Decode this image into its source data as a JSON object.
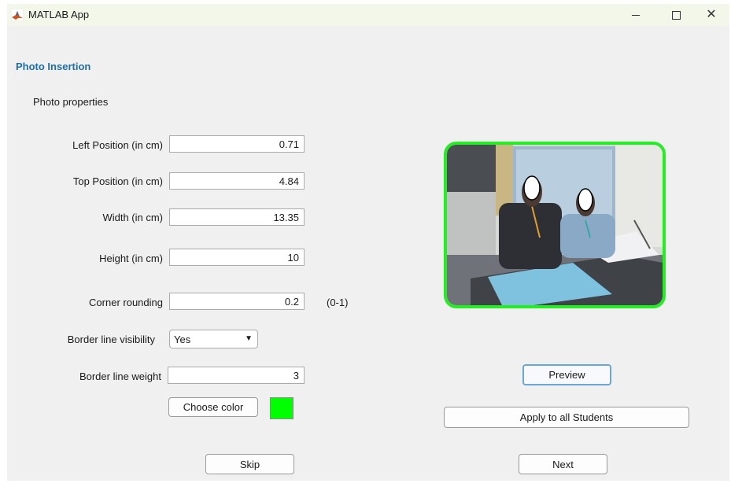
{
  "window": {
    "title": "MATLAB App"
  },
  "header": {
    "section_title": "Photo Insertion",
    "group_label": "Photo properties"
  },
  "fields": {
    "left_position": {
      "label": "Left Position (in cm)",
      "value": "0.71"
    },
    "top_position": {
      "label": "Top Position (in cm)",
      "value": "4.84"
    },
    "width": {
      "label": "Width (in cm)",
      "value": "13.35"
    },
    "height": {
      "label": "Height (in cm)",
      "value": "10"
    },
    "corner_rounding": {
      "label": "Corner rounding",
      "value": "0.2",
      "range_hint": "(0-1)"
    },
    "border_visibility": {
      "label": "Border line visibility",
      "value": "Yes"
    },
    "border_weight": {
      "label": "Border line weight",
      "value": "3"
    }
  },
  "buttons": {
    "choose_color": "Choose color",
    "preview": "Preview",
    "apply_all": "Apply to all Students",
    "skip": "Skip",
    "next": "Next"
  },
  "colors": {
    "border_color": "#00ff00",
    "section_title": "#1e6fa8"
  },
  "icons": {
    "app": "matlab-icon",
    "minimize": "minimize-icon",
    "maximize": "maximize-icon",
    "close": "close-icon",
    "dropdown": "chevron-down-icon"
  }
}
